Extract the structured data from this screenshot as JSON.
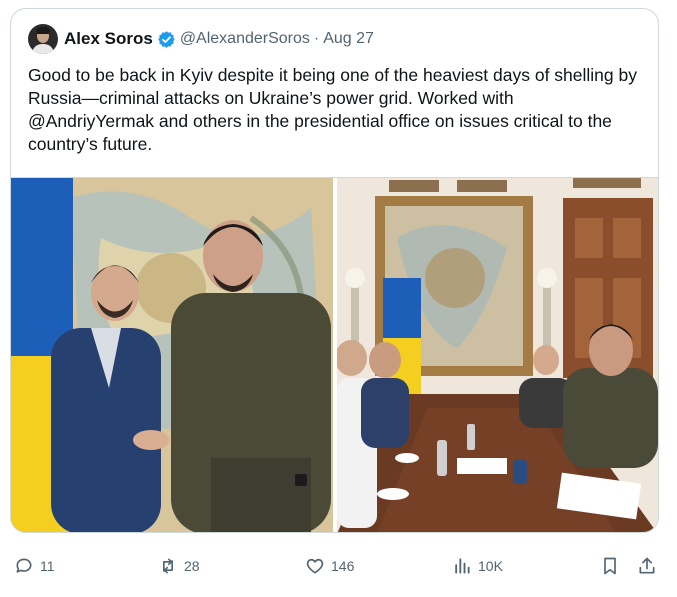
{
  "tweet": {
    "author_name": "Alex Soros",
    "handle": "@AlexanderSoros",
    "separator": "·",
    "date": "Aug 27",
    "text": "Good to be back in Kyiv despite it being one of the heaviest days of shelling by Russia—criminal attacks on Ukraine’s power grid. Worked with @AndriyYermak and others in the presidential office on issues critical to the country’s future."
  },
  "actions": {
    "replies": "11",
    "reposts": "28",
    "likes": "146",
    "views": "10K"
  },
  "icons": {
    "verified": "verified-badge-icon",
    "reply": "reply-icon",
    "repost": "repost-icon",
    "like": "heart-icon",
    "views": "views-icon",
    "bookmark": "bookmark-icon",
    "share": "share-icon"
  },
  "colors": {
    "verified": "#1d9bf0",
    "muted": "#536471",
    "border": "#cfd9de"
  }
}
